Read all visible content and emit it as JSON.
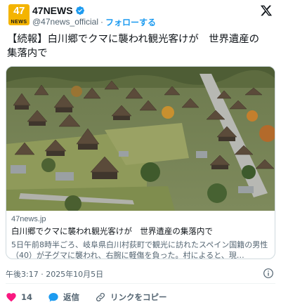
{
  "account": {
    "avatar_number": "47",
    "avatar_sub": "NEWS",
    "display_name": "47NEWS",
    "handle": "@47news_official",
    "separator": "·",
    "follow_label": "フォローする"
  },
  "tweet": {
    "text": "【続報】白川郷でクマに襲われ観光客けが　世界遺産の\n集落内で"
  },
  "card": {
    "domain": "47news.jp",
    "title": "白川郷でクマに襲われ観光客けが　世界遺産の集落内で",
    "description": "5日午前8時半ごろ、岐阜県白川村荻町で観光に訪れたスペイン国籍の男性（40）が子グマに襲われ、右腕に軽傷を負った。村によると、現…"
  },
  "meta": {
    "timestamp": "午後3:17 · 2025年10月5日"
  },
  "actions": {
    "like_count": "14",
    "reply_label": "返信",
    "copy_label": "リンクをコピー"
  },
  "colors": {
    "accent": "#1d9bf0",
    "like": "#f91880",
    "text": "#0f1419",
    "muted": "#536471",
    "avatar_bg": "#f4b400"
  }
}
